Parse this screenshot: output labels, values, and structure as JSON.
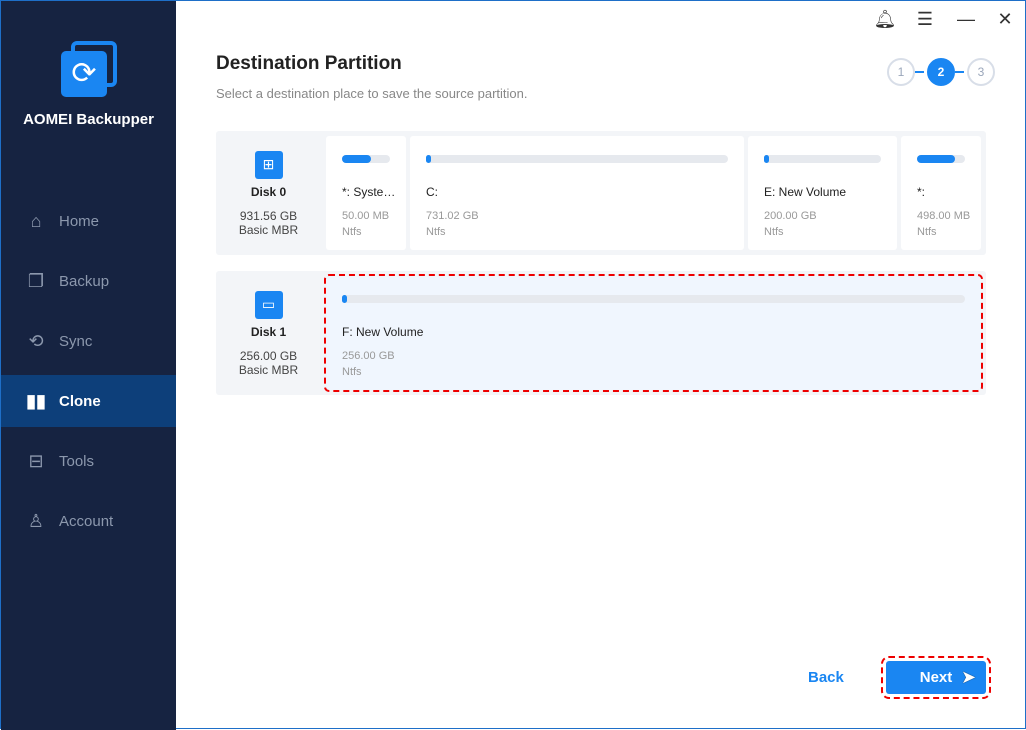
{
  "app": {
    "name": "AOMEI Backupper"
  },
  "sidebar": {
    "items": [
      {
        "label": "Home",
        "icon": "home-icon"
      },
      {
        "label": "Backup",
        "icon": "backup-icon"
      },
      {
        "label": "Sync",
        "icon": "sync-icon"
      },
      {
        "label": "Clone",
        "icon": "clone-icon",
        "active": true
      },
      {
        "label": "Tools",
        "icon": "tools-icon"
      },
      {
        "label": "Account",
        "icon": "account-icon"
      }
    ]
  },
  "header": {
    "title": "Destination Partition",
    "subtitle": "Select a destination place to save the source partition.",
    "steps": [
      "1",
      "2",
      "3"
    ],
    "current_step": 2
  },
  "disks": [
    {
      "name": "Disk 0",
      "size": "931.56 GB",
      "type": "Basic MBR",
      "partitions": [
        {
          "name": "*: System...",
          "size": "50.00 MB",
          "fs": "Ntfs",
          "used": 0.6
        },
        {
          "name": "C:",
          "size": "731.02 GB",
          "fs": "Ntfs",
          "used": 0.01
        },
        {
          "name": "E: New Volume",
          "size": "200.00 GB",
          "fs": "Ntfs",
          "used": 0.01
        },
        {
          "name": "*:",
          "size": "498.00 MB",
          "fs": "Ntfs",
          "used": 0.8
        }
      ]
    },
    {
      "name": "Disk 1",
      "size": "256.00 GB",
      "type": "Basic MBR",
      "partitions": [
        {
          "name": "F: New Volume",
          "size": "256.00 GB",
          "fs": "Ntfs",
          "used": 0.005,
          "selected": true
        }
      ]
    }
  ],
  "footer": {
    "back": "Back",
    "next": "Next"
  },
  "colors": {
    "accent": "#1a86f2",
    "sidebar": "#162341",
    "active": "#0d3f7a"
  }
}
